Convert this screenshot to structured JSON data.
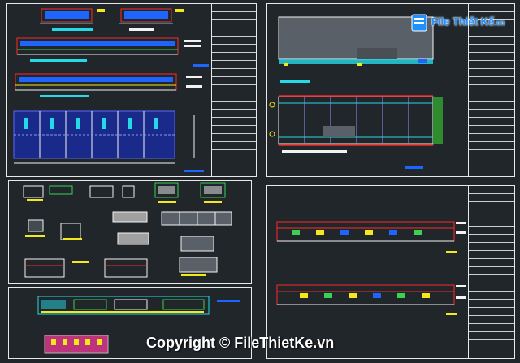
{
  "logo": {
    "name": "File Thiết Kế",
    "suffix": ".vn"
  },
  "watermark": {
    "text": "Copyright © FileThietKe.vn"
  },
  "colors": {
    "background": "#21262b",
    "frame": "#e8e8e8",
    "blue": "#1e64ff",
    "cyan": "#25d9e6",
    "red": "#ff2a2a",
    "yellow": "#f4e71a",
    "green": "#39d353",
    "white": "#f2f2f2"
  }
}
